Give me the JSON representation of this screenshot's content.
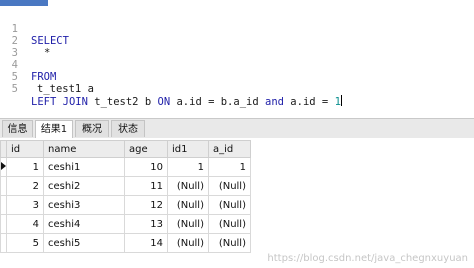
{
  "editor": {
    "lines": [
      {
        "n": "1",
        "t": "SELECT"
      },
      {
        "n": "2",
        "t": "*"
      },
      {
        "n": "3",
        "t": ""
      },
      {
        "n": "4",
        "t": "FROM"
      },
      {
        "n": "5",
        "t": "t_test1 a"
      },
      {
        "n": "5",
        "t": "LEFT JOIN t_test2 b ON a.id = b.a_id and a.id = 1"
      }
    ],
    "sql_parts": {
      "left": "LEFT",
      "join": "JOIN",
      "table": "t_test2",
      "alias": "b",
      "on": "ON",
      "cond1": "a.id = b.a_id",
      "and": "and",
      "cond2": "a.id =",
      "value": "1"
    }
  },
  "tabs": [
    "信息",
    "结果1",
    "概况",
    "状态"
  ],
  "grid": {
    "columns": [
      "id",
      "name",
      "age",
      "id1",
      "a_id"
    ],
    "rows": [
      [
        "1",
        "ceshi1",
        "10",
        "1",
        "1"
      ],
      [
        "2",
        "ceshi2",
        "11",
        "(Null)",
        "(Null)"
      ],
      [
        "3",
        "ceshi3",
        "12",
        "(Null)",
        "(Null)"
      ],
      [
        "4",
        "ceshi4",
        "13",
        "(Null)",
        "(Null)"
      ],
      [
        "5",
        "ceshi5",
        "14",
        "(Null)",
        "(Null)"
      ]
    ]
  },
  "watermark": "https://blog.csdn.net/java_chegnxuyuan"
}
